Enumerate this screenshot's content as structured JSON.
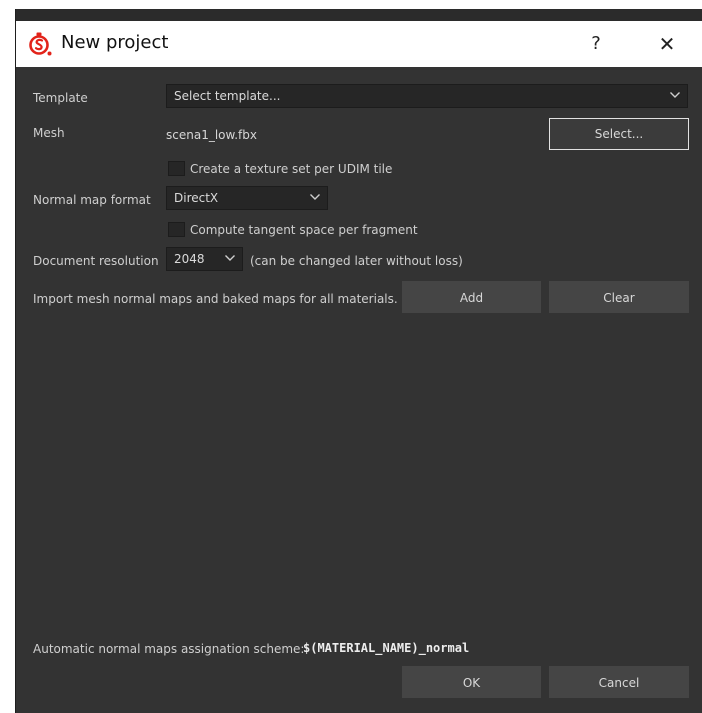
{
  "window": {
    "title": "New project",
    "help_glyph": "?",
    "close_glyph": "✕"
  },
  "template": {
    "label": "Template",
    "value": "Select template..."
  },
  "mesh": {
    "label": "Mesh",
    "value": "scena1_low.fbx",
    "select_button": "Select..."
  },
  "udim": {
    "label": "Create a texture set per UDIM tile",
    "checked": false
  },
  "normal_map": {
    "label": "Normal map format",
    "value": "DirectX"
  },
  "tangent": {
    "label": "Compute tangent space per fragment",
    "checked": false
  },
  "resolution": {
    "label": "Document resolution",
    "value": "2048",
    "hint": "(can be changed later without loss)"
  },
  "import": {
    "label": "Import mesh normal maps and baked maps for all materials.",
    "add_button": "Add",
    "clear_button": "Clear"
  },
  "scheme": {
    "label": "Automatic normal maps assignation scheme:",
    "value": "$(MATERIAL_NAME)_normal"
  },
  "footer": {
    "ok_button": "OK",
    "cancel_button": "Cancel"
  },
  "colors": {
    "accent_logo": "#e2231a",
    "panel_bg": "#333333",
    "field_bg": "#262626",
    "button_bg": "#454545"
  },
  "icons": {
    "logo": "substance-painter-logo-icon",
    "dropdown": "chevron-down-icon",
    "close": "close-icon",
    "help": "help-icon"
  }
}
